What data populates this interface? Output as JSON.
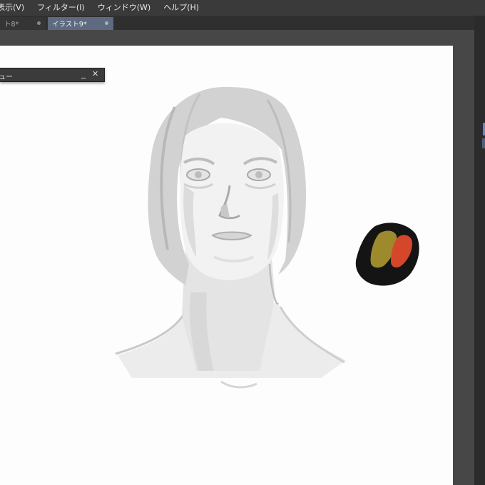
{
  "menu": {
    "items": [
      {
        "label": "表示(V)"
      },
      {
        "label": "フィルター(I)"
      },
      {
        "label": "ウィンドウ(W)"
      },
      {
        "label": "ヘルプ(H)"
      }
    ]
  },
  "tabs": [
    {
      "label": "ト8*",
      "active": false
    },
    {
      "label": "イラスト9*",
      "active": true
    }
  ],
  "floating_panel": {
    "title": "ュー",
    "minimize_symbol": "_",
    "close_symbol": "✕"
  },
  "colors": {
    "accent": "#5e6a80",
    "canvas": "#fdfdfd",
    "palette_black": "#141414",
    "palette_olive": "#9c8a2c",
    "palette_red": "#d4472a"
  }
}
